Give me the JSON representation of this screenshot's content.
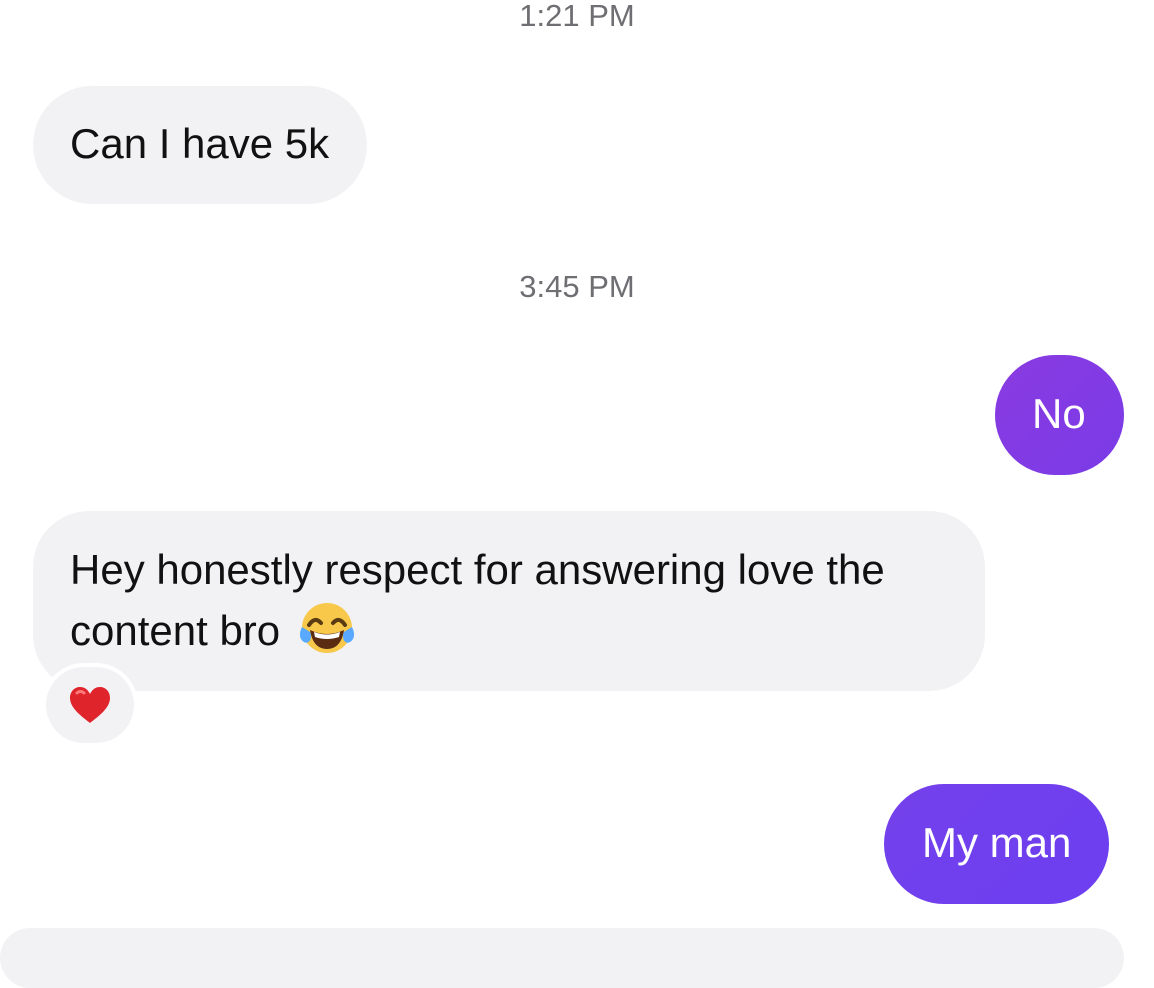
{
  "thread": {
    "timestamps": [
      "1:21 PM",
      "3:45 PM"
    ],
    "messages": [
      {
        "direction": "incoming",
        "text": "Can I have 5k"
      },
      {
        "direction": "outgoing",
        "text": "No"
      },
      {
        "direction": "incoming",
        "text": "Hey honestly respect for answering love the content bro",
        "emoji": "laughing-with-tears-icon",
        "reaction": "red-heart-icon"
      },
      {
        "direction": "outgoing",
        "text": "My man"
      }
    ]
  },
  "colors": {
    "incoming_bubble": "#f2f2f4",
    "outgoing_bubble_1": "#8a3be0",
    "outgoing_bubble_2": "#6c3ff0",
    "timestamp_text": "#6e6e73"
  }
}
